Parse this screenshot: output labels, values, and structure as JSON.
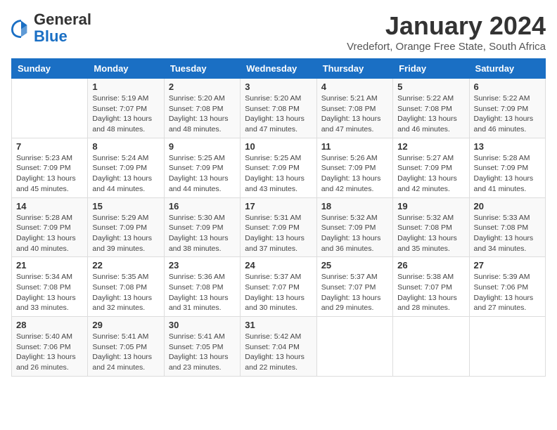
{
  "logo": {
    "general": "General",
    "blue": "Blue"
  },
  "header": {
    "title": "January 2024",
    "subtitle": "Vredefort, Orange Free State, South Africa"
  },
  "weekdays": [
    "Sunday",
    "Monday",
    "Tuesday",
    "Wednesday",
    "Thursday",
    "Friday",
    "Saturday"
  ],
  "weeks": [
    [
      {
        "day": "",
        "info": ""
      },
      {
        "day": "1",
        "info": "Sunrise: 5:19 AM\nSunset: 7:07 PM\nDaylight: 13 hours\nand 48 minutes."
      },
      {
        "day": "2",
        "info": "Sunrise: 5:20 AM\nSunset: 7:08 PM\nDaylight: 13 hours\nand 48 minutes."
      },
      {
        "day": "3",
        "info": "Sunrise: 5:20 AM\nSunset: 7:08 PM\nDaylight: 13 hours\nand 47 minutes."
      },
      {
        "day": "4",
        "info": "Sunrise: 5:21 AM\nSunset: 7:08 PM\nDaylight: 13 hours\nand 47 minutes."
      },
      {
        "day": "5",
        "info": "Sunrise: 5:22 AM\nSunset: 7:08 PM\nDaylight: 13 hours\nand 46 minutes."
      },
      {
        "day": "6",
        "info": "Sunrise: 5:22 AM\nSunset: 7:09 PM\nDaylight: 13 hours\nand 46 minutes."
      }
    ],
    [
      {
        "day": "7",
        "info": "Sunrise: 5:23 AM\nSunset: 7:09 PM\nDaylight: 13 hours\nand 45 minutes."
      },
      {
        "day": "8",
        "info": "Sunrise: 5:24 AM\nSunset: 7:09 PM\nDaylight: 13 hours\nand 44 minutes."
      },
      {
        "day": "9",
        "info": "Sunrise: 5:25 AM\nSunset: 7:09 PM\nDaylight: 13 hours\nand 44 minutes."
      },
      {
        "day": "10",
        "info": "Sunrise: 5:25 AM\nSunset: 7:09 PM\nDaylight: 13 hours\nand 43 minutes."
      },
      {
        "day": "11",
        "info": "Sunrise: 5:26 AM\nSunset: 7:09 PM\nDaylight: 13 hours\nand 42 minutes."
      },
      {
        "day": "12",
        "info": "Sunrise: 5:27 AM\nSunset: 7:09 PM\nDaylight: 13 hours\nand 42 minutes."
      },
      {
        "day": "13",
        "info": "Sunrise: 5:28 AM\nSunset: 7:09 PM\nDaylight: 13 hours\nand 41 minutes."
      }
    ],
    [
      {
        "day": "14",
        "info": "Sunrise: 5:28 AM\nSunset: 7:09 PM\nDaylight: 13 hours\nand 40 minutes."
      },
      {
        "day": "15",
        "info": "Sunrise: 5:29 AM\nSunset: 7:09 PM\nDaylight: 13 hours\nand 39 minutes."
      },
      {
        "day": "16",
        "info": "Sunrise: 5:30 AM\nSunset: 7:09 PM\nDaylight: 13 hours\nand 38 minutes."
      },
      {
        "day": "17",
        "info": "Sunrise: 5:31 AM\nSunset: 7:09 PM\nDaylight: 13 hours\nand 37 minutes."
      },
      {
        "day": "18",
        "info": "Sunrise: 5:32 AM\nSunset: 7:09 PM\nDaylight: 13 hours\nand 36 minutes."
      },
      {
        "day": "19",
        "info": "Sunrise: 5:32 AM\nSunset: 7:08 PM\nDaylight: 13 hours\nand 35 minutes."
      },
      {
        "day": "20",
        "info": "Sunrise: 5:33 AM\nSunset: 7:08 PM\nDaylight: 13 hours\nand 34 minutes."
      }
    ],
    [
      {
        "day": "21",
        "info": "Sunrise: 5:34 AM\nSunset: 7:08 PM\nDaylight: 13 hours\nand 33 minutes."
      },
      {
        "day": "22",
        "info": "Sunrise: 5:35 AM\nSunset: 7:08 PM\nDaylight: 13 hours\nand 32 minutes."
      },
      {
        "day": "23",
        "info": "Sunrise: 5:36 AM\nSunset: 7:08 PM\nDaylight: 13 hours\nand 31 minutes."
      },
      {
        "day": "24",
        "info": "Sunrise: 5:37 AM\nSunset: 7:07 PM\nDaylight: 13 hours\nand 30 minutes."
      },
      {
        "day": "25",
        "info": "Sunrise: 5:37 AM\nSunset: 7:07 PM\nDaylight: 13 hours\nand 29 minutes."
      },
      {
        "day": "26",
        "info": "Sunrise: 5:38 AM\nSunset: 7:07 PM\nDaylight: 13 hours\nand 28 minutes."
      },
      {
        "day": "27",
        "info": "Sunrise: 5:39 AM\nSunset: 7:06 PM\nDaylight: 13 hours\nand 27 minutes."
      }
    ],
    [
      {
        "day": "28",
        "info": "Sunrise: 5:40 AM\nSunset: 7:06 PM\nDaylight: 13 hours\nand 26 minutes."
      },
      {
        "day": "29",
        "info": "Sunrise: 5:41 AM\nSunset: 7:05 PM\nDaylight: 13 hours\nand 24 minutes."
      },
      {
        "day": "30",
        "info": "Sunrise: 5:41 AM\nSunset: 7:05 PM\nDaylight: 13 hours\nand 23 minutes."
      },
      {
        "day": "31",
        "info": "Sunrise: 5:42 AM\nSunset: 7:04 PM\nDaylight: 13 hours\nand 22 minutes."
      },
      {
        "day": "",
        "info": ""
      },
      {
        "day": "",
        "info": ""
      },
      {
        "day": "",
        "info": ""
      }
    ]
  ]
}
